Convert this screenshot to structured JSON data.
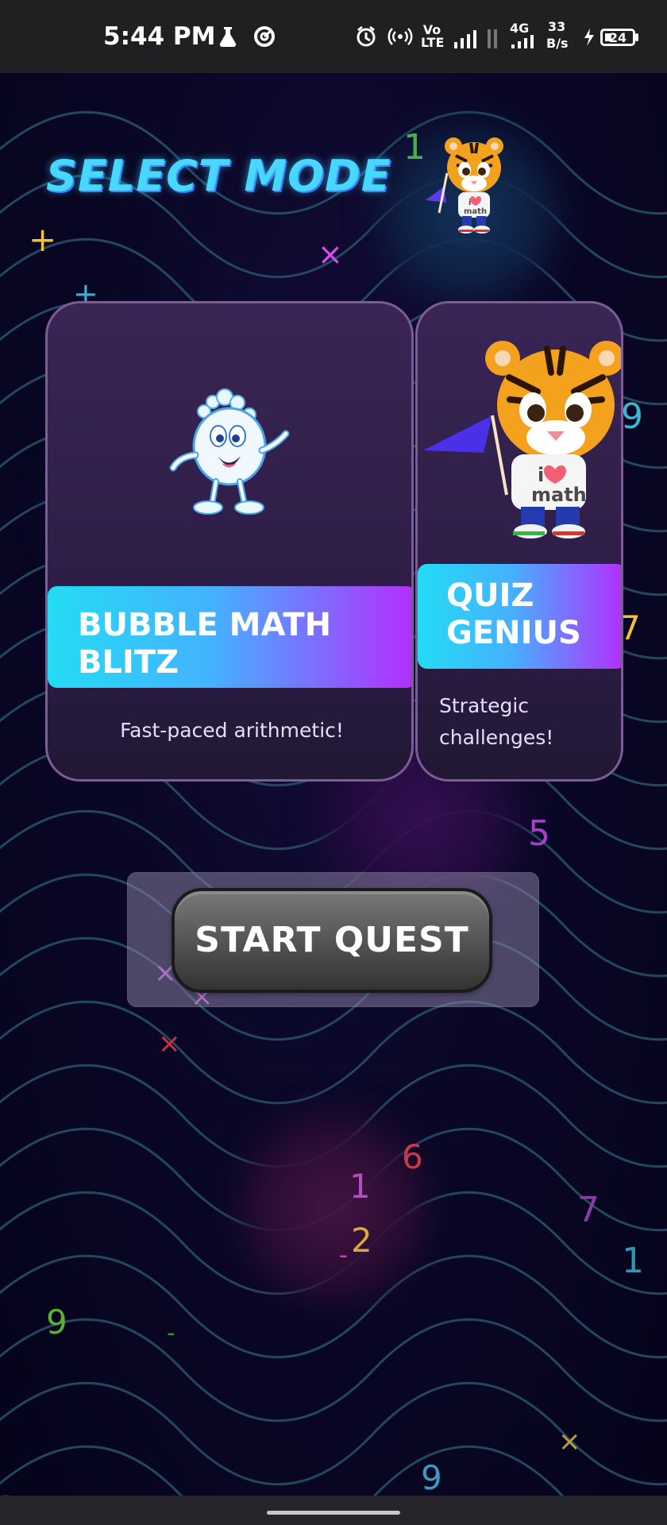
{
  "status": {
    "time": "5:44 PM",
    "network_top": "Vo\nLTE",
    "network_4g": "4G",
    "speed_value": "33",
    "speed_unit": "B/s",
    "battery": "24"
  },
  "screen": {
    "title": "SELECT MODE"
  },
  "modes": [
    {
      "title_line_1": "BUBBLE MATH",
      "title_line_2": "BLITZ",
      "description": "Fast-paced arithmetic!"
    },
    {
      "title_line_1": "QUIZ",
      "title_line_2": "GENIUS",
      "description_line_1": "Strategic",
      "description_line_2": "challenges!"
    }
  ],
  "actions": {
    "start_label": "START QUEST"
  },
  "tiger_shirt_text": {
    "line_1": "i",
    "line_2": "math"
  },
  "floating_symbols": [
    "1",
    "+",
    "×",
    "+",
    "9",
    "7",
    "5",
    "×",
    "×",
    "×",
    "6",
    "1",
    "7",
    "2",
    "-",
    "1",
    "9",
    "-",
    "×",
    "9",
    "-"
  ],
  "icons": {
    "status": [
      "lab-icon",
      "target-icon",
      "alarm-icon",
      "hotspot-icon",
      "signal-icon",
      "signal-icon",
      "battery-icon"
    ],
    "characters": [
      "tiger-mascot-icon",
      "bubble-mascot-icon"
    ]
  }
}
